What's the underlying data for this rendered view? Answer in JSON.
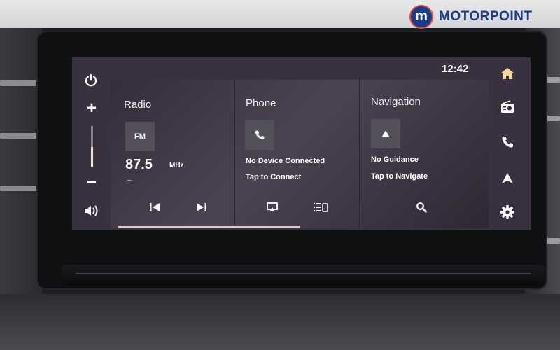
{
  "brand": {
    "name": "MOTORPOINT",
    "mark": "m"
  },
  "status_bar": {
    "clock": "12:42"
  },
  "left_controls": {
    "power_icon": "power-icon",
    "volume_up": "+",
    "volume_down": "−",
    "speaker_icon": "speaker-icon",
    "volume_level": 0.48
  },
  "right_nav": [
    {
      "name": "home-icon"
    },
    {
      "name": "radio-icon"
    },
    {
      "name": "phone-icon"
    },
    {
      "name": "navigation-icon"
    },
    {
      "name": "settings-icon"
    }
  ],
  "radio": {
    "title": "Radio",
    "band": "FM",
    "frequency": "87.5",
    "unit": "MHz",
    "station": "–"
  },
  "phone": {
    "title": "Phone",
    "status": "No Device Connected",
    "hint": "Tap to Connect"
  },
  "navigation": {
    "title": "Navigation",
    "status": "No Guidance",
    "hint": "Tap to Navigate"
  },
  "colors": {
    "brand_blue": "#1a3c8c",
    "brand_red": "#e64a3b",
    "screen_bg": "#3a3140",
    "tile_bg": "#54505a"
  },
  "progress": {
    "fraction": 0.48
  }
}
